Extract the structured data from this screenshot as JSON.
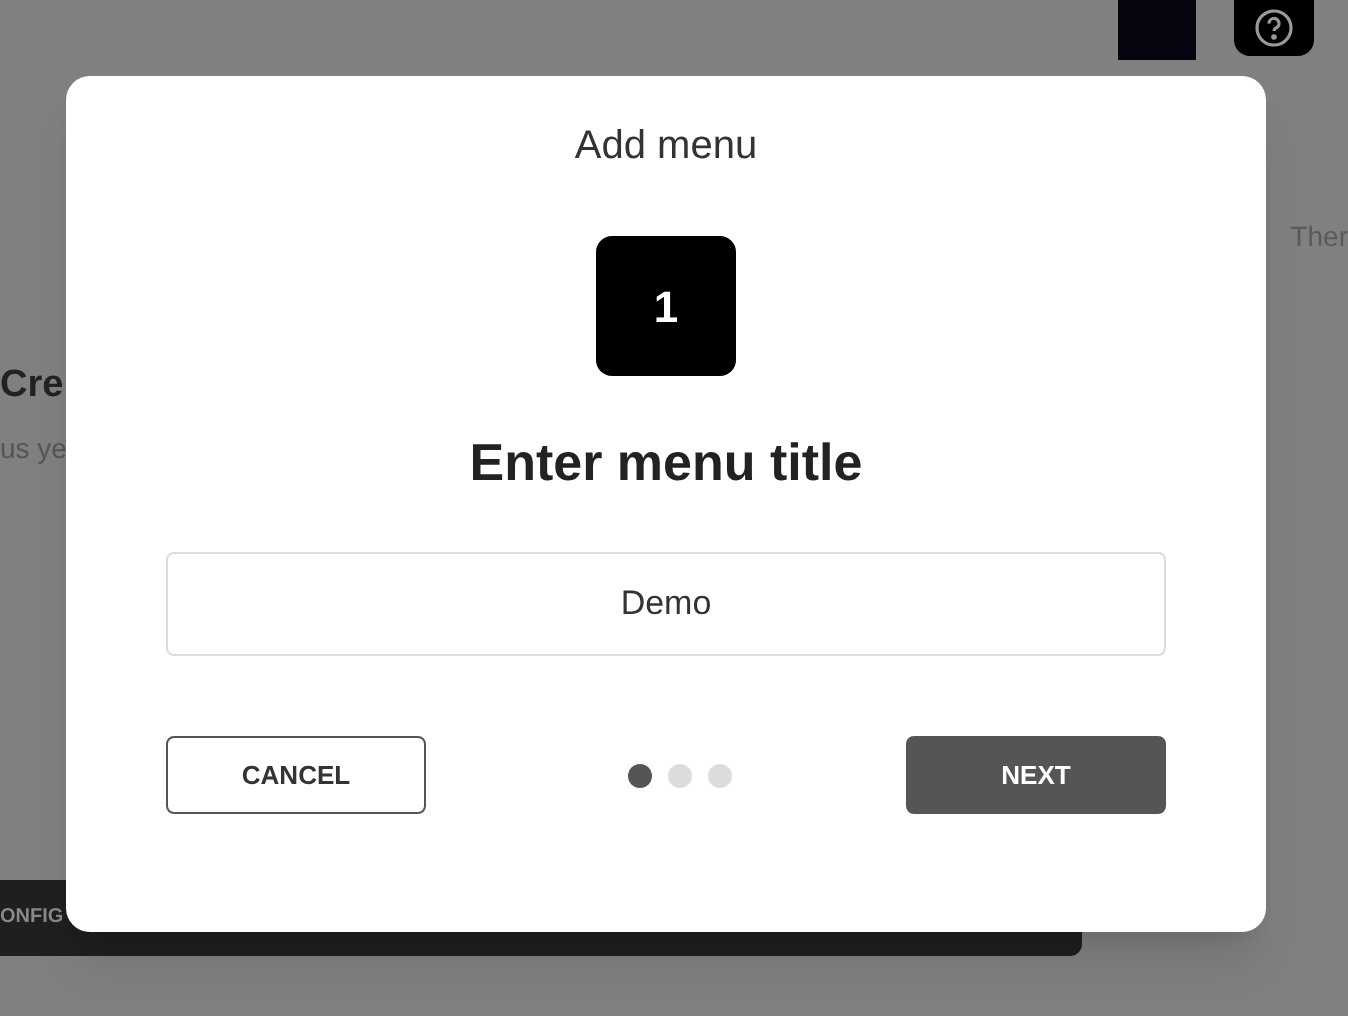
{
  "background": {
    "side_text": "Ther",
    "card_title": "Cre",
    "card_text": "us ye",
    "bar_label": "ONFIG"
  },
  "modal": {
    "title": "Add menu",
    "step": "1",
    "heading": "Enter menu title",
    "input": {
      "value": "Demo"
    },
    "cancel": "CANCEL",
    "next": "NEXT",
    "dots": [
      {
        "selected": true
      },
      {
        "selected": false
      },
      {
        "selected": false
      }
    ]
  }
}
